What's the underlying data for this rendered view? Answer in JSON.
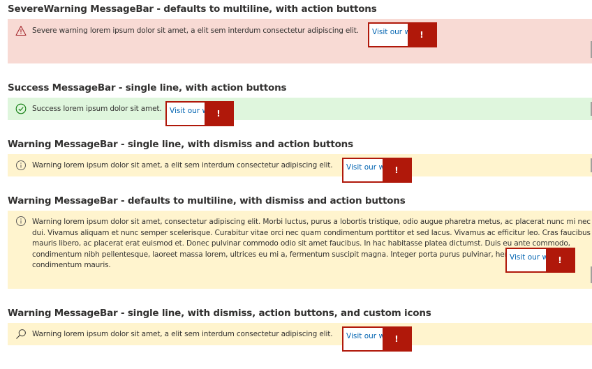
{
  "sections": [
    {
      "heading": "SevereWarning MessageBar - defaults to multiline, with action buttons",
      "text": "Severe warning lorem ipsum dolor sit amet, a elit sem interdum consectetur adipiscing elit.",
      "link": "Visit our w",
      "icon": "warning-triangle-icon"
    },
    {
      "heading": "Success MessageBar - single line, with action buttons",
      "text": "Success lorem ipsum dolor sit amet.",
      "link": "Visit our w",
      "icon": "check-circle-icon"
    },
    {
      "heading": "Warning MessageBar - single line, with dismiss and action buttons",
      "text": "Warning lorem ipsum dolor sit amet, a elit sem interdum consectetur adipiscing elit.",
      "link": "Visit our w",
      "icon": "info-circle-icon"
    },
    {
      "heading": "Warning MessageBar - defaults to multiline, with dismiss and action buttons",
      "text": "Warning lorem ipsum dolor sit amet, consectetur adipiscing elit. Morbi luctus, purus a lobortis tristique, odio augue pharetra metus, ac placerat nunc mi nec dui. Vivamus aliquam et nunc semper scelerisque. Curabitur vitae orci nec quam condimentum porttitor et sed lacus. Vivamus ac efficitur leo. Cras faucibus mauris libero, ac placerat erat euismod et. Donec pulvinar commodo odio sit amet faucibus. In hac habitasse platea dictumst. Duis eu ante commodo, condimentum nibh pellentesque, laoreet massa lorem, ultrices eu mi a, fermentum suscipit magna. Integer porta purus pulvinar, hendrerit felis eget, condimentum mauris.",
      "link": "Visit our w",
      "icon": "info-circle-icon"
    },
    {
      "heading": "Warning MessageBar - single line, with dismiss, action buttons, and custom icons",
      "text": "Warning lorem ipsum dolor sit amet, a elit sem interdum consectetur adipiscing elit.",
      "link": "Visit our w",
      "icon": "search-icon"
    }
  ],
  "alert_glyph": "!",
  "colors": {
    "severe_bg": "#f8dad4",
    "success_bg": "#dff6dd",
    "warning_bg": "#fff4ce",
    "link": "#0063b1",
    "alert_red": "#b0180a",
    "text": "#323130"
  }
}
